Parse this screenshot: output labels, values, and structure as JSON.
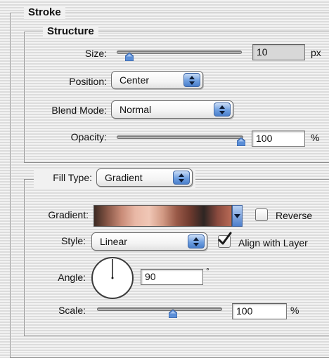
{
  "stroke_group": {
    "title": "Stroke"
  },
  "structure_group": {
    "title": "Structure",
    "size": {
      "label": "Size:",
      "value": "10",
      "unit": "px",
      "slider_fraction": 0.1
    },
    "position": {
      "label": "Position:",
      "value": "Center"
    },
    "blend_mode": {
      "label": "Blend Mode:",
      "value": "Normal"
    },
    "opacity": {
      "label": "Opacity:",
      "value": "100",
      "unit": "%",
      "slider_fraction": 1.0
    }
  },
  "fill_group": {
    "fill_type": {
      "label": "Fill Type:",
      "value": "Gradient"
    },
    "gradient": {
      "label": "Gradient:",
      "colors": [
        "#3c2a22",
        "#8a5848",
        "#c98c78",
        "#e9b8a6",
        "#f0c7b6",
        "#d29a84",
        "#9a5a48",
        "#6e3a2e",
        "#2e2523",
        "#8a4a3e",
        "#b86a56"
      ],
      "reverse_label": "Reverse",
      "reverse_checked": false
    },
    "style": {
      "label": "Style:",
      "value": "Linear"
    },
    "align_with_layer": {
      "label": "Align with Layer",
      "checked": true
    },
    "angle": {
      "label": "Angle:",
      "value": "90",
      "unit": "°"
    },
    "scale": {
      "label": "Scale:",
      "value": "100",
      "unit": "%",
      "slider_fraction": 0.5
    }
  },
  "colors": {
    "accent_blue": "#5b8fd8",
    "checkmark": "#1a1a1a"
  },
  "icons": {
    "popup_arrow": "up-down-arrows-icon",
    "slider_thumb": "slider-thumb-icon",
    "checkmark": "checkmark-icon",
    "angle_dial": "angle-dial-icon"
  }
}
